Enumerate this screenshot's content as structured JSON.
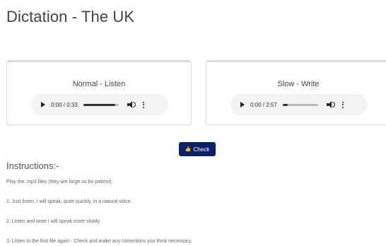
{
  "page": {
    "title": "Dictation - The UK"
  },
  "players": [
    {
      "label": "Normal - Listen",
      "time": "0:00 / 0:33",
      "progress": 0.9
    },
    {
      "label": "Slow - Write",
      "time": "0:00 / 2:57",
      "progress": 0.15
    }
  ],
  "check": {
    "label": "Check",
    "icon": "thumbs-up-icon"
  },
  "instructions": {
    "heading": "Instructions:-",
    "lines": [
      "Play the .mp3 files (they are large so be patient).",
      "1. Just listen. I will speak, quite quickly, in a natural voice.",
      "2. Listen and write I will speak more slowly.",
      "3. Listen to the first file again - Check and make any corrections you think necessary."
    ]
  }
}
